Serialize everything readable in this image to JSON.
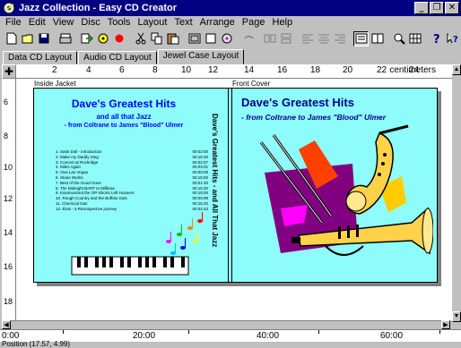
{
  "window": {
    "title": "Jazz Collection - Easy CD Creator"
  },
  "window_buttons": {
    "minimize": "_",
    "maximize": "❐",
    "close": "✕"
  },
  "menu": [
    "File",
    "Edit",
    "View",
    "Disc",
    "Tools",
    "Layout",
    "Text",
    "Arrange",
    "Page",
    "Help"
  ],
  "tabs": [
    {
      "label": "Data CD Layout",
      "active": false
    },
    {
      "label": "Audio CD Layout",
      "active": false
    },
    {
      "label": "Jewel Case Layout",
      "active": true
    }
  ],
  "ruler": {
    "numbers": [
      "2",
      "4",
      "6",
      "8",
      "10",
      "12",
      "14",
      "16",
      "18",
      "20",
      "22",
      "24"
    ],
    "units": "centimeters",
    "vertical": [
      "6",
      "8",
      "10",
      "12",
      "14",
      "16",
      "18"
    ]
  },
  "canvas": {
    "inside_label": "Inside Jacket",
    "front_label": "Front Cover",
    "left": {
      "title": "Dave's Greatest Hits",
      "subtitle": "and all that Jazz",
      "byline": "- from Coltrane to James \"Blood\" Ulmer",
      "tracks": [
        {
          "name": "1. Satin Doll - introduction",
          "time": "00:02:00"
        },
        {
          "name": "2. Make my Daddy Sing",
          "time": "00:15:20"
        },
        {
          "name": "3. Concert at Rockridge",
          "time": "00:02:07"
        },
        {
          "name": "4. Miles Again",
          "time": "00:03:01"
        },
        {
          "name": "5. Viva Las Vegas",
          "time": "00:00:09"
        },
        {
          "name": "6. Stone Works",
          "time": "00:15:00"
        },
        {
          "name": "7. Best of the Good Ones",
          "time": "00:01:30"
        },
        {
          "name": "8. The Midnight BART to Millbrae",
          "time": "00:15:20"
        },
        {
          "name": "9. Kisamusstrut the OP-Shorts Left Housers",
          "time": "00:15:00"
        },
        {
          "name": "10. Rough Country and the Buffalo Gals",
          "time": "00:00:09"
        },
        {
          "name": "11. Chemical Gas",
          "time": "00:15:20"
        },
        {
          "name": "12. Elvis - a Retrospective journey",
          "time": "00:02:43"
        }
      ]
    },
    "spine_text": "Dave's Greatest Hits - and All That Jazz",
    "right": {
      "title": "Dave's Greatest Hits",
      "subtitle": "- from Coltrane to James \"Blood\" Ulmer"
    }
  },
  "timeline": {
    "marks": [
      "0:00",
      "20:00",
      "40:00",
      "60:00"
    ]
  },
  "status": {
    "position": "Position (17.57, 4.99)"
  },
  "colors": {
    "titlebar": "#000080",
    "cover_bg": "#8ffcfc",
    "title_blue": "#0000ff"
  }
}
